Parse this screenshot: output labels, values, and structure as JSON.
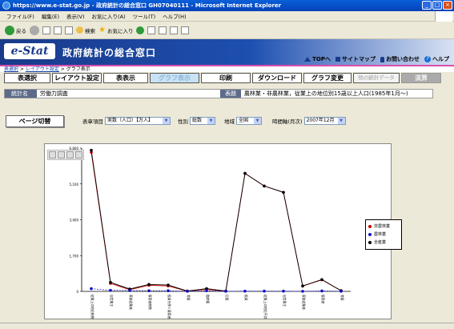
{
  "window": {
    "title": "https://www.e-stat.go.jp - 政府統計の総合窓口 GH07040111 - Microsoft Internet Explorer"
  },
  "menu": [
    "ファイル(F)",
    "編集(E)",
    "表示(V)",
    "お気に入り(A)",
    "ツール(T)",
    "ヘルプ(H)"
  ],
  "toolbar": {
    "back": "戻る",
    "search": "検索",
    "favorites": "お気に入り"
  },
  "header": {
    "logo": "e-Stat",
    "title": "政府統計の総合窓口",
    "links": [
      "TOPへ",
      "サイトマップ",
      "お問い合わせ",
      "ヘルプ"
    ]
  },
  "breadcrumb": [
    "表選択",
    "レイアウト設定",
    "グラフ表示"
  ],
  "tabs": [
    "表選択",
    "レイアウト設定",
    "表表示",
    "グラフ表示",
    "印刷",
    "ダウンロード",
    "グラフ変更",
    "他の統計データ",
    "演算"
  ],
  "info": {
    "stat_label": "統計名",
    "stat_value": "労働力調査",
    "table_label": "表題",
    "table_value": "農林業・非農林業，従業上の地位別15歳以上人口(1985年1月～)"
  },
  "controls": {
    "page_button": "ページ切替",
    "item_label": "表章項目",
    "item_value": "実数（人口）【万人】",
    "sex_label": "性別",
    "sex_value": "総数",
    "area_label": "地域",
    "area_value": "全国",
    "time_label": "時間軸(月次)",
    "time_value": "2007年12月"
  },
  "chart_data": {
    "type": "line",
    "categories": [
      "従業上の地位総数",
      "自営業主",
      "家族従業者",
      "雇用者総数",
      "役員を除く雇用者",
      "常雇",
      "臨時雇",
      "日雇",
      "役員",
      "従業上の地位不詳",
      "自営業主",
      "家族従業者",
      "雇用者",
      "常雇"
    ],
    "series": [
      {
        "name": "非農林業",
        "color": "#cc0000",
        "values": [
          6600,
          380,
          80,
          290,
          260,
          10,
          100,
          10,
          5600,
          5000,
          4700,
          250,
          550,
          30
        ]
      },
      {
        "name": "農林業",
        "color": "#1111cc",
        "values": [
          130,
          50,
          40,
          30,
          30,
          5,
          30,
          5,
          10,
          10,
          10,
          5,
          20,
          5
        ]
      },
      {
        "name": "全産業",
        "color": "#000000",
        "values": [
          6700,
          430,
          110,
          330,
          300,
          15,
          130,
          15,
          5600,
          5000,
          4700,
          260,
          560,
          35
        ]
      }
    ],
    "ylim": [
      0,
      6800
    ],
    "yticks": [
      "0",
      "1,700",
      "3,400",
      "5,100",
      "6,800"
    ]
  }
}
